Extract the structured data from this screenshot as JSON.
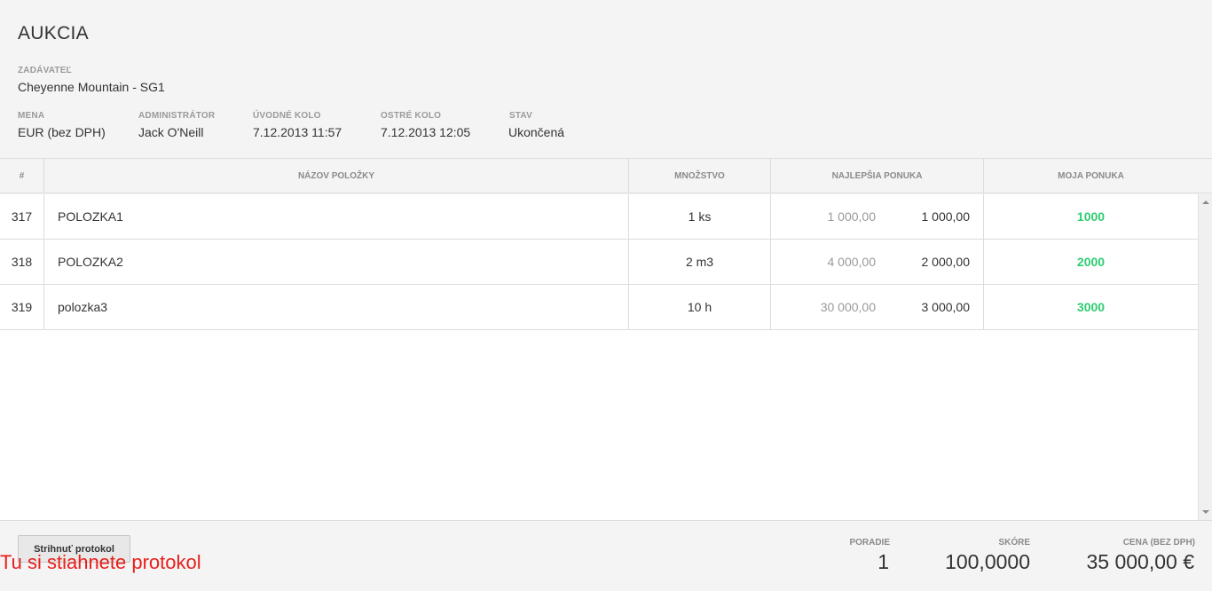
{
  "page": {
    "title": "AUKCIA"
  },
  "requester": {
    "label": "ZADÁVATEĽ",
    "value": "Cheyenne Mountain - SG1"
  },
  "details": [
    {
      "label": "MENA",
      "value": "EUR (bez DPH)"
    },
    {
      "label": "ADMINISTRÁTOR",
      "value": "Jack O'Neill"
    },
    {
      "label": "ÚVODNÉ KOLO",
      "value": "7.12.2013 11:57"
    },
    {
      "label": "OSTRÉ KOLO",
      "value": "7.12.2013 12:05"
    },
    {
      "label": "STAV",
      "value": "Ukončená"
    }
  ],
  "table": {
    "headers": [
      "#",
      "NÁZOV POLOŽKY",
      "MNOŽSTVO",
      "NAJLEPŠIA PONUKA",
      "MOJA PONUKA"
    ],
    "rows": [
      {
        "id": "317",
        "name": "POLOZKA1",
        "quantity": "1 ks",
        "best_initial": "1 000,00",
        "best_current": "1 000,00",
        "my_offer": "1000"
      },
      {
        "id": "318",
        "name": "POLOZKA2",
        "quantity": "2 m3",
        "best_initial": "4 000,00",
        "best_current": "2 000,00",
        "my_offer": "2000"
      },
      {
        "id": "319",
        "name": "polozka3",
        "quantity": "10 h",
        "best_initial": "30 000,00",
        "best_current": "3 000,00",
        "my_offer": "3000"
      }
    ]
  },
  "footer": {
    "download_button": "Strihnuť protokol",
    "annotation": "Tu si stiahnete protokol",
    "rank": {
      "label": "PORADIE",
      "value": "1"
    },
    "score": {
      "label": "SKÓRE",
      "value": "100,0000"
    },
    "price": {
      "label": "CENA (BEZ DPH)",
      "value": "35 000,00 €"
    }
  },
  "colors": {
    "my_offer": "#2ecc71",
    "annotation": "#e8201c"
  }
}
